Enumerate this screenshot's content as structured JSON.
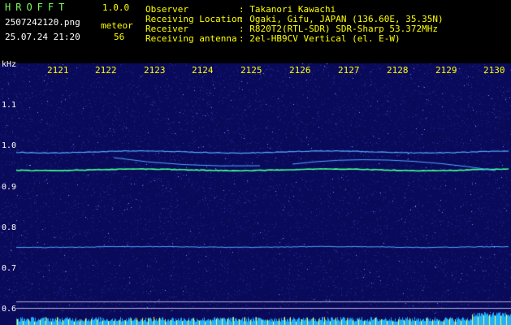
{
  "header": {
    "brand": "HROFFT",
    "version": "1.0.0",
    "filename": "2507242120.png",
    "datetime": "25.07.24 21:20",
    "meteor_label": "meteor",
    "meteor_count": "56",
    "info_labels": [
      "Observer",
      "Receiving Location",
      "Receiver",
      "Receiving antenna"
    ],
    "info_values": [
      ": Takanori Kawachi",
      ": Ogaki, Gifu, JAPAN (136.60E, 35.35N)",
      ": R820T2(RTL-SDR) SDR-Sharp 53.372MHz",
      ": 2el-HB9CV Vertical (el. E-W)"
    ]
  },
  "spectrogram": {
    "time_ticks": [
      "2121",
      "2122",
      "2123",
      "2124",
      "2125",
      "2126",
      "2127",
      "2128",
      "2129",
      "2130"
    ],
    "freq_unit": "kHz",
    "freq_ticks": [
      "1.1",
      "1.0",
      "0.9",
      "0.8",
      "0.7",
      "0.6"
    ],
    "colors": {
      "background": "#0a0a5a",
      "trace": "#4fa8ff",
      "hot": "#40ff90",
      "bar": "#1fb0ff"
    }
  }
}
